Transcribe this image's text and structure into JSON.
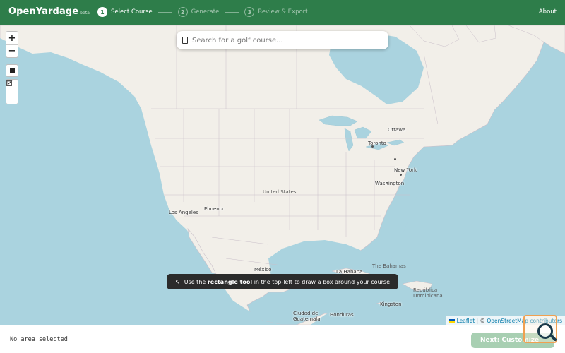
{
  "header": {
    "brand": "OpenYardage",
    "brand_tag": "beta",
    "steps": [
      {
        "num": "1",
        "label": "Select Course",
        "state": "active"
      },
      {
        "num": "2",
        "label": "Generate",
        "state": "inactive"
      },
      {
        "num": "3",
        "label": "Review & Export",
        "state": "inactive"
      }
    ],
    "about": "About"
  },
  "map": {
    "zoom_in": "+",
    "zoom_out": "−",
    "search_placeholder": "Search for a golf course...",
    "hint_prefix": "Use the",
    "hint_bold": "rectangle tool",
    "hint_suffix": "in the top-left to draw a box around your course",
    "hint_icon": "↖",
    "cities": [
      "Ottawa",
      "Toronto",
      "New York",
      "Washington",
      "Los Angeles",
      "Phoenix",
      "México",
      "La Habana",
      "Kingston",
      "Ciudad de Guatemala",
      "Honduras"
    ],
    "countries": [
      "United States",
      "The Bahamas",
      "República Dominicana"
    ],
    "attribution_leaflet": "Leaflet",
    "attribution_sep": "| ©",
    "attribution_osm": "OpenStreetMap contributors"
  },
  "footer": {
    "status": "No area selected",
    "next_button": "Next: Customize"
  },
  "colors": {
    "header_green": "#2e7d4a",
    "water": "#aad3df",
    "land": "#f2efe9",
    "button_disabled": "#a8cfb2"
  }
}
